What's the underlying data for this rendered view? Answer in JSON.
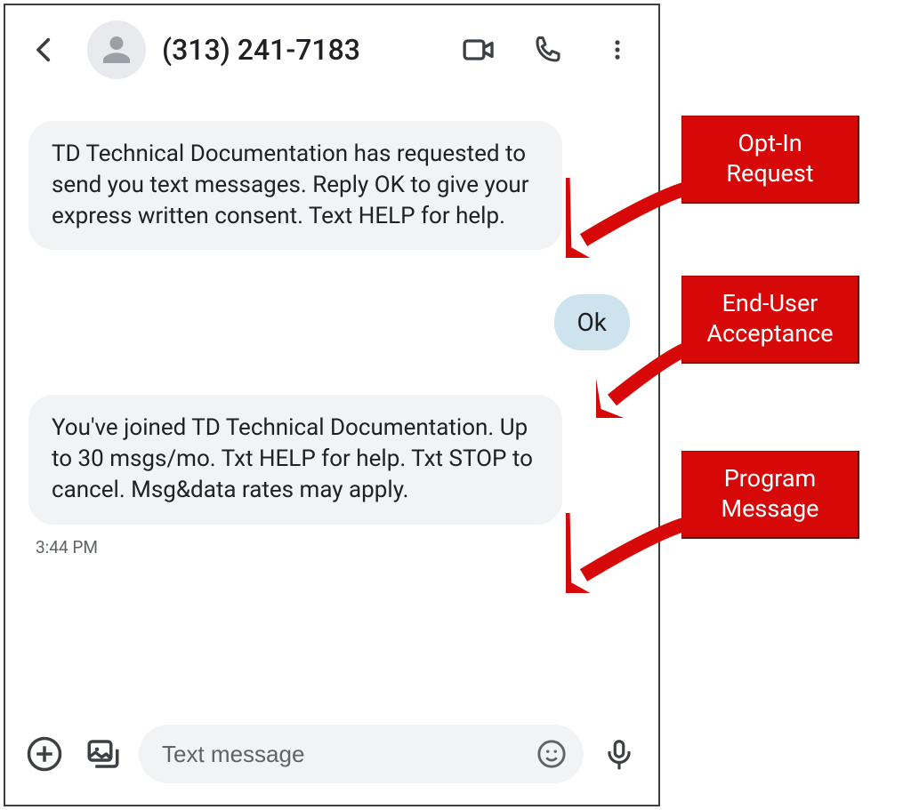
{
  "header": {
    "contact_name": "(313) 241-7183"
  },
  "thread": {
    "messages": [
      {
        "direction": "in",
        "text": "TD Technical Documentation has requested to send you text messages. Reply OK to give your express written consent. Text HELP for help."
      },
      {
        "direction": "out",
        "text": "Ok"
      },
      {
        "direction": "in",
        "text": "You've joined TD Technical Documentation. Up to 30 msgs/mo. Txt HELP for help. Txt STOP to cancel. Msg&data rates may apply."
      }
    ],
    "timestamp": "3:44 PM"
  },
  "composer": {
    "placeholder": "Text message"
  },
  "callouts": [
    {
      "label": "Opt-In\nRequest"
    },
    {
      "label": "End-User\nAcceptance"
    },
    {
      "label": "Program\nMessage"
    }
  ]
}
